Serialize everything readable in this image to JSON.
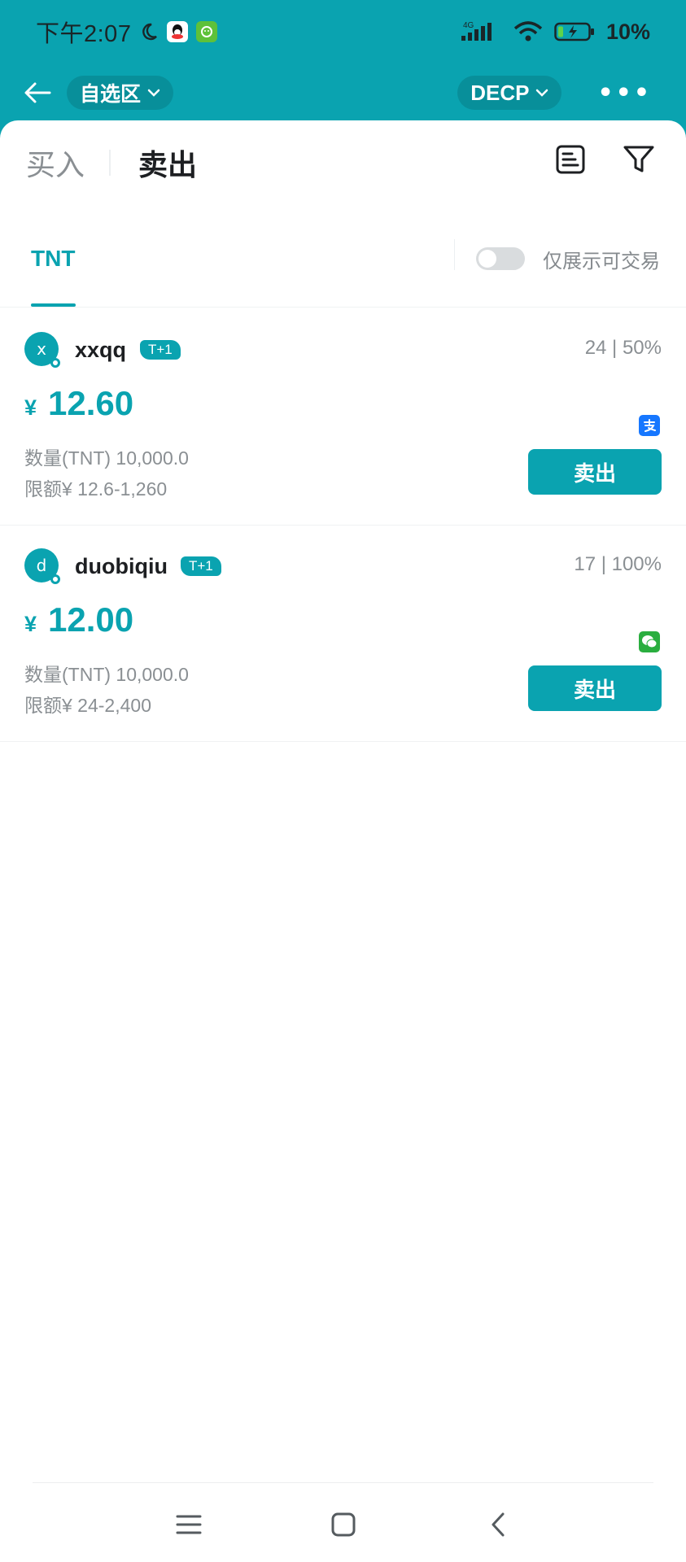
{
  "status_bar": {
    "time": "下午2:07",
    "network": "4G",
    "battery": "10%"
  },
  "top_nav": {
    "favorites_label": "自选区",
    "currency_label": "DECP",
    "more_label": "•••"
  },
  "trade_tabs": {
    "buy_label": "买入",
    "sell_label": "卖出",
    "active": "sell"
  },
  "coin_tabs": {
    "items": [
      "TNT"
    ],
    "toggle_label": "仅展示可交易",
    "toggle_on": false
  },
  "offers": [
    {
      "avatar_letter": "x",
      "user_name": "xxqq",
      "settle_badge": "T+1",
      "stats": "24 | 50%",
      "price_symbol": "¥",
      "price": "12.60",
      "payment_icon": "alipay-icon",
      "payment_color": "#1677ff",
      "quantity": "数量(TNT) 10,000.0",
      "limit": "限额¥ 12.6-1,260",
      "action_label": "卖出"
    },
    {
      "avatar_letter": "d",
      "user_name": "duobiqiu",
      "settle_badge": "T+1",
      "stats": "17 | 100%",
      "price_symbol": "¥",
      "price": "12.00",
      "payment_icon": "wechat-pay-icon",
      "payment_color": "#2aae3f",
      "quantity": "数量(TNT) 10,000.0",
      "limit": "限额¥ 24-2,400",
      "action_label": "卖出"
    }
  ],
  "colors": {
    "accent": "#0aa3b0",
    "muted_text": "#8a8f93"
  }
}
